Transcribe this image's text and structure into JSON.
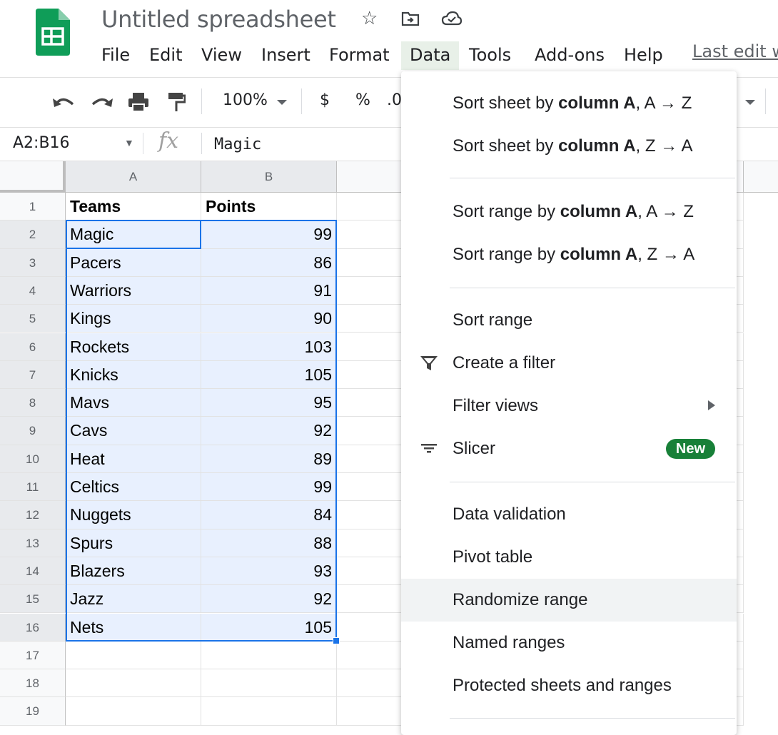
{
  "app": {
    "doc_title": "Untitled spreadsheet",
    "menu": [
      "File",
      "Edit",
      "View",
      "Insert",
      "Format",
      "Data",
      "Tools",
      "Add-ons",
      "Help"
    ],
    "active_menu": "Data",
    "last_edit": "Last edit w"
  },
  "toolbar": {
    "zoom": "100%",
    "currency": "$",
    "percent": "%",
    "decimal": ".0"
  },
  "formula_bar": {
    "name_box": "A2:B16",
    "fx": "fx",
    "value": "Magic"
  },
  "sheet": {
    "columns": [
      "A",
      "B"
    ],
    "rows": [
      {
        "num": "1",
        "a": "Teams",
        "b": "Points"
      },
      {
        "num": "2",
        "a": "Magic",
        "b": "99"
      },
      {
        "num": "3",
        "a": "Pacers",
        "b": "86"
      },
      {
        "num": "4",
        "a": "Warriors",
        "b": "91"
      },
      {
        "num": "5",
        "a": "Kings",
        "b": "90"
      },
      {
        "num": "6",
        "a": "Rockets",
        "b": "103"
      },
      {
        "num": "7",
        "a": "Knicks",
        "b": "105"
      },
      {
        "num": "8",
        "a": "Mavs",
        "b": "95"
      },
      {
        "num": "9",
        "a": "Cavs",
        "b": "92"
      },
      {
        "num": "10",
        "a": "Heat",
        "b": "89"
      },
      {
        "num": "11",
        "a": "Celtics",
        "b": "99"
      },
      {
        "num": "12",
        "a": "Nuggets",
        "b": "84"
      },
      {
        "num": "13",
        "a": "Spurs",
        "b": "88"
      },
      {
        "num": "14",
        "a": "Blazers",
        "b": "93"
      },
      {
        "num": "15",
        "a": "Jazz",
        "b": "92"
      },
      {
        "num": "16",
        "a": "Nets",
        "b": "105"
      },
      {
        "num": "17",
        "a": "",
        "b": ""
      },
      {
        "num": "18",
        "a": "",
        "b": ""
      },
      {
        "num": "19",
        "a": "",
        "b": ""
      }
    ]
  },
  "data_menu": {
    "sort_sheet_az": {
      "pre": "Sort sheet by ",
      "bold": "column A",
      "post": ", A → Z"
    },
    "sort_sheet_za": {
      "pre": "Sort sheet by ",
      "bold": "column A",
      "post": ", Z → A"
    },
    "sort_range_az": {
      "pre": "Sort range by ",
      "bold": "column A",
      "post": ", A → Z"
    },
    "sort_range_za": {
      "pre": "Sort range by ",
      "bold": "column A",
      "post": ", Z → A"
    },
    "sort_range": "Sort range",
    "create_filter": "Create a filter",
    "filter_views": "Filter views",
    "slicer": "Slicer",
    "slicer_badge": "New",
    "data_validation": "Data validation",
    "pivot_table": "Pivot table",
    "randomize_range": "Randomize range",
    "named_ranges": "Named ranges",
    "protected": "Protected sheets and ranges"
  },
  "colors": {
    "selection_fill": "#e8f0fe",
    "selection_border": "#1a73e8",
    "badge": "#188038",
    "logo": "#0f9d58"
  }
}
